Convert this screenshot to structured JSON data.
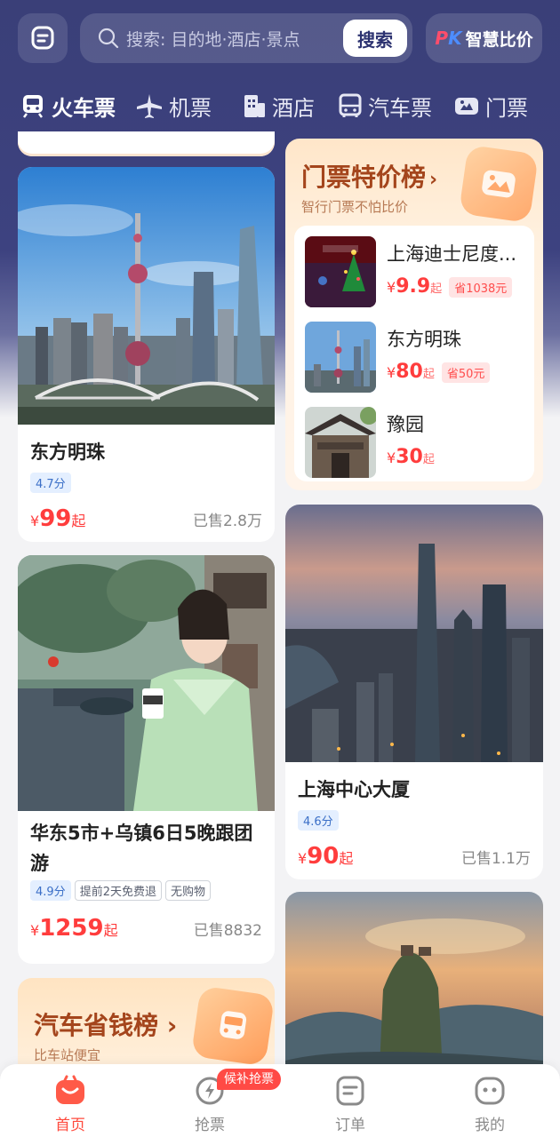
{
  "search": {
    "placeholder": "搜索: 目的地·酒店·景点",
    "button": "搜索"
  },
  "pk": {
    "logo_p": "P",
    "logo_k": "K",
    "label": "智慧比价"
  },
  "tabs": [
    {
      "label": "火车票",
      "icon": "train-icon",
      "active": true
    },
    {
      "label": "机票",
      "icon": "plane-icon",
      "active": false
    },
    {
      "label": "酒店",
      "icon": "hotel-icon",
      "active": false
    },
    {
      "label": "汽车票",
      "icon": "bus-icon",
      "active": false
    },
    {
      "label": "门票",
      "icon": "ticket-icon",
      "active": false
    }
  ],
  "cards": {
    "oriental_pearl": {
      "title": "东方明珠",
      "rating": "4.7分",
      "yen": "¥",
      "price": "99",
      "qi": "起",
      "sold": "已售2.8万"
    },
    "tour": {
      "title": "华东5市+乌镇6日5晚跟团游",
      "rating": "4.9分",
      "tags": [
        "提前2天免费退",
        "无购物"
      ],
      "yen": "¥",
      "price": "1259",
      "qi": "起",
      "sold": "已售8832"
    },
    "shanghai_center": {
      "title": "上海中心大厦",
      "rating": "4.6分",
      "yen": "¥",
      "price": "90",
      "qi": "起",
      "sold": "已售1.1万"
    }
  },
  "ticket_rank": {
    "title": "门票特价榜",
    "arrow": "›",
    "subtitle": "智行门票不怕比价",
    "items": [
      {
        "name": "上海迪士尼度...",
        "yen": "¥",
        "price": "9.9",
        "qi": "起",
        "save": "省1038元"
      },
      {
        "name": "东方明珠",
        "yen": "¥",
        "price": "80",
        "qi": "起",
        "save": "省50元"
      },
      {
        "name": "豫园",
        "yen": "¥",
        "price": "30",
        "qi": "起",
        "save": ""
      }
    ]
  },
  "bus_rank": {
    "title": "汽车省钱榜",
    "arrow": "›",
    "subtitle": "比车站便宜"
  },
  "bottom_nav": {
    "items": [
      {
        "label": "首页",
        "icon": "home-icon",
        "active": true
      },
      {
        "label": "抢票",
        "icon": "grab-ticket-icon",
        "active": false
      },
      {
        "label": "订单",
        "icon": "order-icon",
        "active": false
      },
      {
        "label": "我的",
        "icon": "profile-icon",
        "active": false
      }
    ],
    "badge": "候补抢票"
  },
  "colors": {
    "header": "#3a3f78",
    "price": "#ff3d3d",
    "accent": "#ff4a3d",
    "rank_title": "#a4451c"
  }
}
